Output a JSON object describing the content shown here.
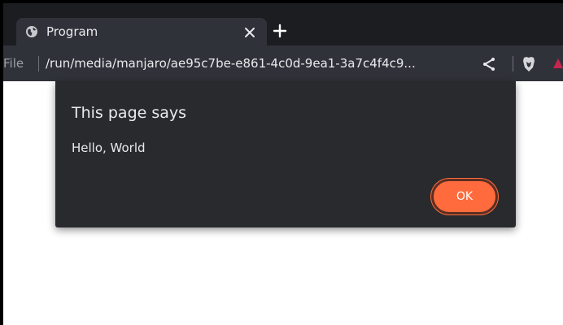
{
  "browser": {
    "tab": {
      "title": "Program",
      "favicon": "globe-icon",
      "close_icon": "close-icon"
    },
    "new_tab_icon": "plus-icon",
    "address_bar": {
      "scheme_label": "File",
      "url": "/run/media/manjaro/ae95c7be-e861-4c0d-9ea1-3a7c4f4c9..."
    },
    "toolbar_icons": [
      "share-icon",
      "brave-shields-icon",
      "brave-rewards-icon"
    ]
  },
  "dialog": {
    "title": "This page says",
    "message": "Hello, World",
    "ok_label": "OK"
  },
  "colors": {
    "tabstrip": "#1c1d21",
    "toolbar": "#303239",
    "dialog_bg": "#292a2d",
    "text": "#e8eaed",
    "accent": "#ff6b3d",
    "page_bg": "#ffffff"
  }
}
